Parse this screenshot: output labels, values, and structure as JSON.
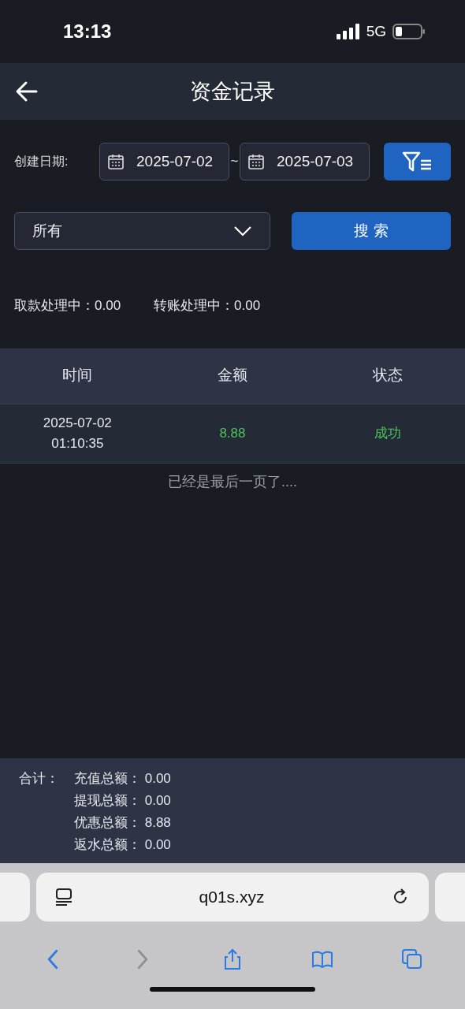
{
  "status_bar": {
    "time": "13:13",
    "network": "5G"
  },
  "header": {
    "title": "资金记录"
  },
  "filters": {
    "date_label": "创建日期:",
    "start_date": "2025-07-02",
    "separator": "~",
    "end_date": "2025-07-03",
    "type_select": "所有",
    "search_button": "搜 索"
  },
  "pending": [
    {
      "label": "取款处理中：",
      "value": "0.00"
    },
    {
      "label": "转账处理中：",
      "value": "0.00"
    }
  ],
  "table": {
    "columns": [
      "时间",
      "金额",
      "状态"
    ],
    "rows": [
      {
        "time_date": "2025-07-02",
        "time_clock": "01:10:35",
        "amount": "8.88",
        "status": "成功",
        "kind": "success"
      }
    ],
    "footer_note": "已经是最后一页了...."
  },
  "totals": {
    "label": "合计：",
    "items": [
      {
        "label": "充值总额：",
        "value": "0.00"
      },
      {
        "label": "提现总额：",
        "value": "0.00"
      },
      {
        "label": "优惠总额：",
        "value": "8.88"
      },
      {
        "label": "返水总额：",
        "value": "0.00"
      }
    ]
  },
  "browser": {
    "url": "q01s.xyz",
    "nav_buttons": [
      {
        "kind": "back",
        "disabled": false
      },
      {
        "kind": "forward",
        "disabled": true
      },
      {
        "kind": "share",
        "disabled": false
      },
      {
        "kind": "bookmarks",
        "disabled": false
      },
      {
        "kind": "tabs",
        "disabled": false
      }
    ]
  }
}
